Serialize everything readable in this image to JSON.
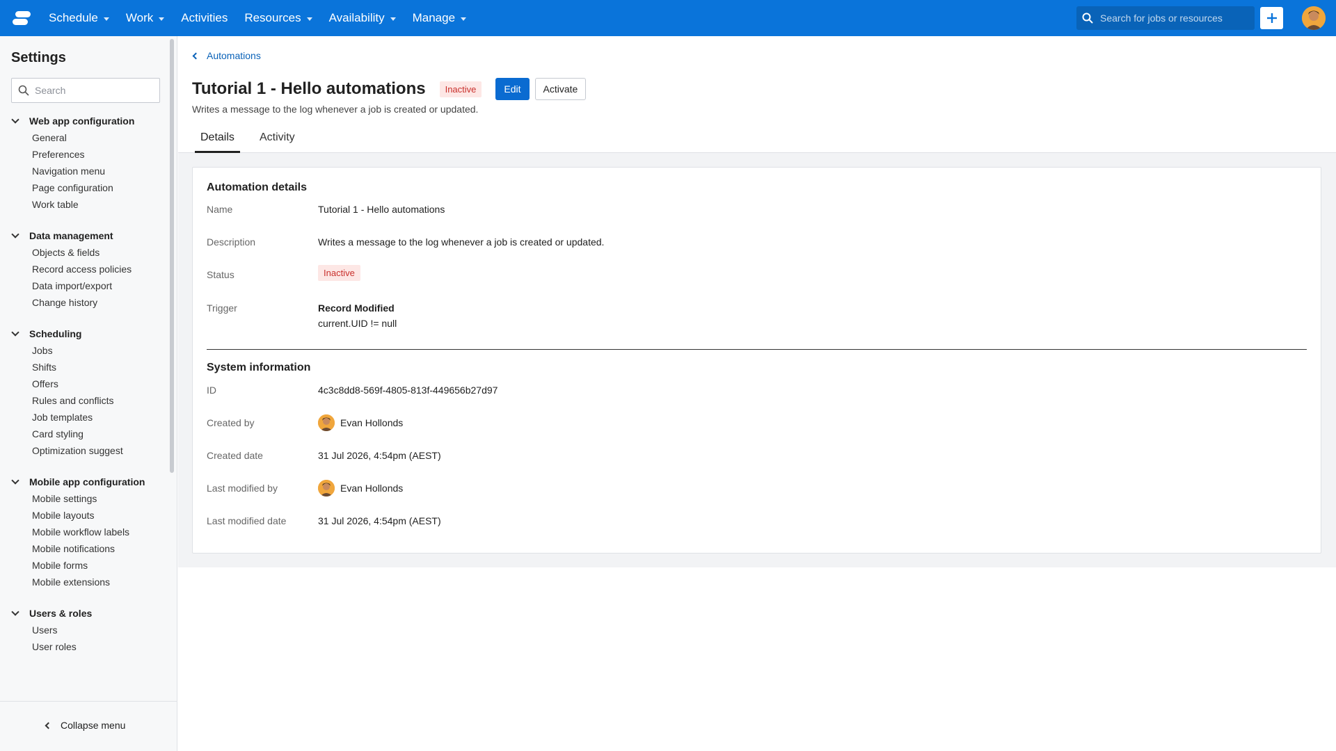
{
  "topnav": {
    "items": [
      {
        "label": "Schedule",
        "dropdown": true
      },
      {
        "label": "Work",
        "dropdown": true
      },
      {
        "label": "Activities",
        "dropdown": false
      },
      {
        "label": "Resources",
        "dropdown": true
      },
      {
        "label": "Availability",
        "dropdown": true
      },
      {
        "label": "Manage",
        "dropdown": true
      }
    ],
    "search_placeholder": "Search for jobs or resources"
  },
  "sidebar": {
    "title": "Settings",
    "search_placeholder": "Search",
    "groups": [
      {
        "label": "Web app configuration",
        "items": [
          "General",
          "Preferences",
          "Navigation menu",
          "Page configuration",
          "Work table"
        ]
      },
      {
        "label": "Data management",
        "items": [
          "Objects & fields",
          "Record access policies",
          "Data import/export",
          "Change history"
        ]
      },
      {
        "label": "Scheduling",
        "items": [
          "Jobs",
          "Shifts",
          "Offers",
          "Rules and conflicts",
          "Job templates",
          "Card styling",
          "Optimization suggest"
        ]
      },
      {
        "label": "Mobile app configuration",
        "items": [
          "Mobile settings",
          "Mobile layouts",
          "Mobile workflow labels",
          "Mobile notifications",
          "Mobile forms",
          "Mobile extensions"
        ]
      },
      {
        "label": "Users & roles",
        "items": [
          "Users",
          "User roles"
        ]
      }
    ],
    "collapse_label": "Collapse menu"
  },
  "header": {
    "breadcrumb": "Automations",
    "title": "Tutorial 1 - Hello automations",
    "status_badge": "Inactive",
    "edit_label": "Edit",
    "activate_label": "Activate",
    "subtitle": "Writes a message to the log whenever a job is created or updated."
  },
  "tabs": [
    {
      "label": "Details",
      "active": true
    },
    {
      "label": "Activity",
      "active": false
    }
  ],
  "details": {
    "section_title": "Automation details",
    "name_label": "Name",
    "name_value": "Tutorial 1 - Hello automations",
    "description_label": "Description",
    "description_value": "Writes a message to the log whenever a job is created or updated.",
    "status_label": "Status",
    "status_value": "Inactive",
    "trigger_label": "Trigger",
    "trigger_value": "Record Modified",
    "trigger_condition": "current.UID != null"
  },
  "system": {
    "section_title": "System information",
    "id_label": "ID",
    "id_value": "4c3c8dd8-569f-4805-813f-449656b27d97",
    "created_by_label": "Created by",
    "created_by_value": "Evan Hollonds",
    "created_date_label": "Created date",
    "created_date_value": "31 Jul 2026, 4:54pm (AEST)",
    "modified_by_label": "Last modified by",
    "modified_by_value": "Evan Hollonds",
    "modified_date_label": "Last modified date",
    "modified_date_value": "31 Jul 2026, 4:54pm (AEST)"
  },
  "colors": {
    "brand": "#0a74da",
    "primary_button": "#0a6bd1",
    "inactive_badge_bg": "#fde7e5",
    "inactive_badge_text": "#c9302c"
  }
}
